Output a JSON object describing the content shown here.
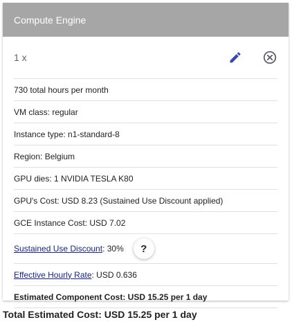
{
  "header": {
    "title": "Compute Engine"
  },
  "item": {
    "quantity": "1 x",
    "edit_icon": "pencil-icon",
    "remove_icon": "circle-x-icon"
  },
  "details": {
    "hours": "730 total hours per month",
    "vm_class": "VM class: regular",
    "instance_type": "Instance type: n1-standard-8",
    "region": "Region: Belgium",
    "gpu_dies": "GPU dies: 1 NVIDIA TESLA K80",
    "gpu_cost": "GPU's Cost: USD 8.23 (Sustained Use Discount applied)",
    "gce_cost": "GCE Instance Cost: USD 7.02",
    "sud_link": "Sustained Use Discount",
    "sud_value": ": 30%",
    "help_label": "?",
    "ehr_link": "Effective Hourly Rate",
    "ehr_value": ": USD 0.636",
    "component_cost": "Estimated Component Cost: USD 15.25 per 1 day"
  },
  "total": {
    "label": "Total Estimated Cost: USD 15.25 per 1 day"
  },
  "colors": {
    "header_bg": "#a6a6a6",
    "icon_blue": "#3949ab",
    "link": "#1a237e"
  }
}
